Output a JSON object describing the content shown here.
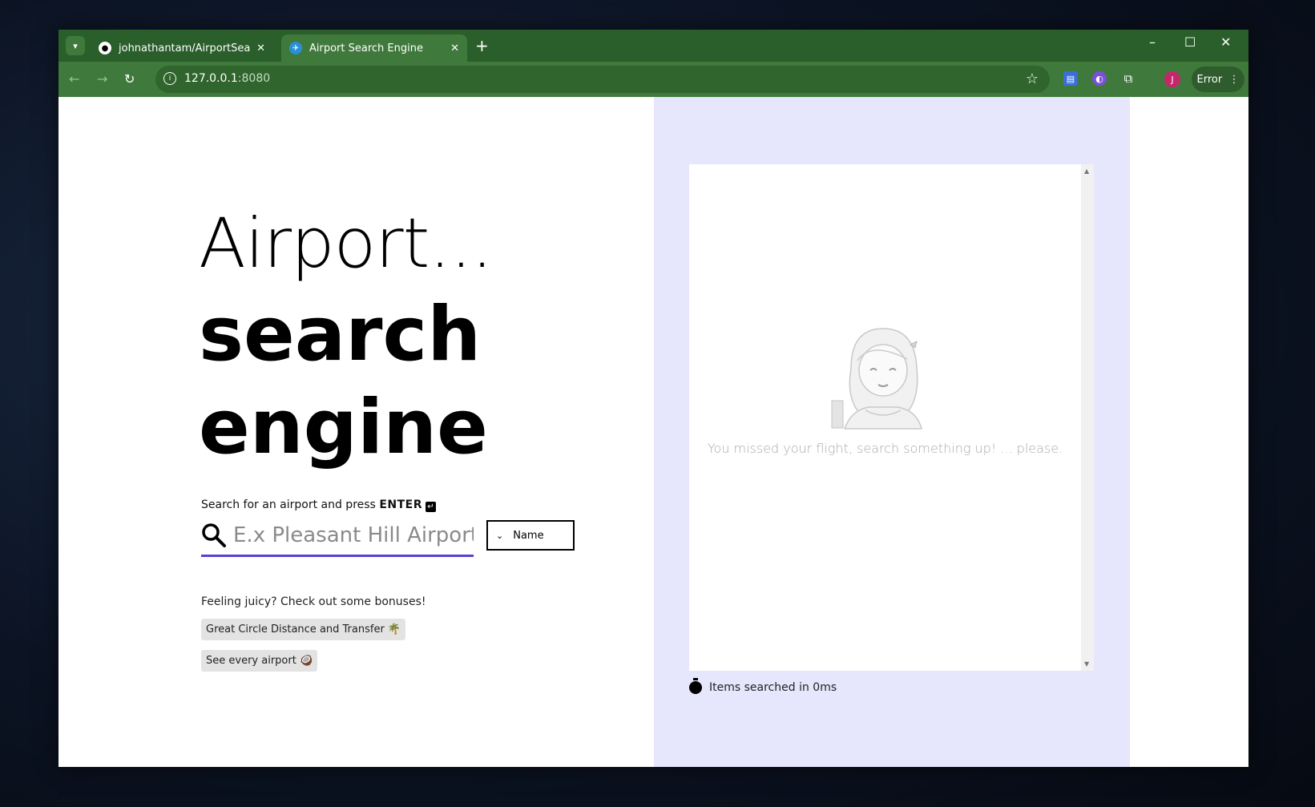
{
  "browser": {
    "tabs": [
      {
        "title": "johnathantam/AirportSearchEn",
        "icon": "github-icon",
        "active": false
      },
      {
        "title": "Airport Search Engine",
        "icon": "airplane-favicon-icon",
        "active": true
      }
    ],
    "url_host": "127.0.0.1",
    "url_port": ":8080",
    "profile_initial": "J",
    "error_label": "Error",
    "theme_color": "#2a5e2a"
  },
  "hero": {
    "line1": "Airport...",
    "line2": "search",
    "line3": "engine"
  },
  "search": {
    "hint_text": "Search for an airport and press ",
    "hint_key": "ENTER",
    "placeholder": "E.x Pleasant Hill Airport",
    "value": "",
    "mode_selected": "Name",
    "accent_color": "#5b3fd2"
  },
  "bonuses": {
    "heading": "Feeling juicy? Check out some bonuses!",
    "items": [
      {
        "label": "Great Circle Distance and Transfer 🌴"
      },
      {
        "label": "See every airport 🥥"
      }
    ]
  },
  "results": {
    "empty_message": "You missed your flight, search something up! ... please.",
    "panel_color": "#e6e6fc"
  },
  "stats": {
    "text": "Items searched in 0ms"
  }
}
